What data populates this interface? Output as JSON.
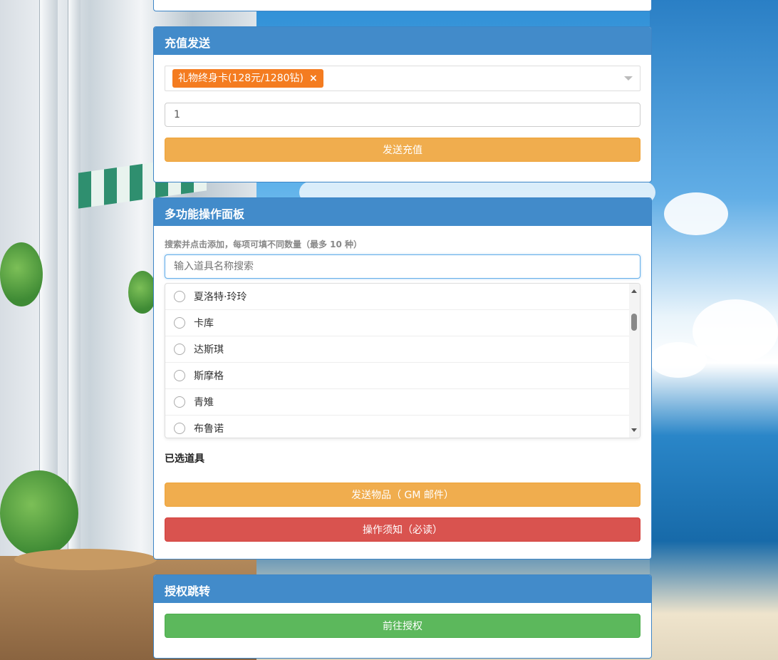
{
  "recharge": {
    "header": "充值发送",
    "selected_tag": "礼物终身卡(128元/1280钻)",
    "tag_remove": "×",
    "quantity_value": "1",
    "send_button": "发送充值"
  },
  "panel": {
    "header": "多功能操作面板",
    "hint": "搜索并点击添加，每项可填不同数量（最多 10 种）",
    "search_placeholder": "输入道具名称搜索",
    "items": [
      {
        "label": "夏洛特·玲玲"
      },
      {
        "label": "卡库"
      },
      {
        "label": "达斯琪"
      },
      {
        "label": "斯摩格"
      },
      {
        "label": "青雉"
      },
      {
        "label": "布鲁诺"
      }
    ],
    "selected_title": "已选道具",
    "send_items_button": "发送物品（ GM 邮件）",
    "notice_button": "操作须知（必读）"
  },
  "auth": {
    "header": "授权跳转",
    "go_button": "前往授权"
  },
  "colors": {
    "header_blue": "#428bca",
    "tag_orange": "#f47c20",
    "warning": "#f0ad4e",
    "danger": "#d9534f",
    "success": "#5cb85c"
  }
}
